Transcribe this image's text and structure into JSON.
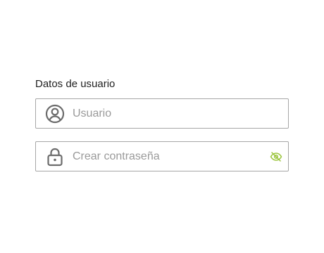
{
  "form": {
    "section_title": "Datos de usuario",
    "username": {
      "placeholder": "Usuario",
      "value": "",
      "icon": "user-circle-icon"
    },
    "password": {
      "placeholder": "Crear contraseña",
      "value": "",
      "icon": "lock-icon",
      "toggle_icon": "eye-off-icon"
    }
  },
  "colors": {
    "border": "#a6a6a6",
    "icon": "#6b6b6b",
    "placeholder": "#9a9a9a",
    "accent": "#9bc53d",
    "text": "#1f1f1f"
  }
}
